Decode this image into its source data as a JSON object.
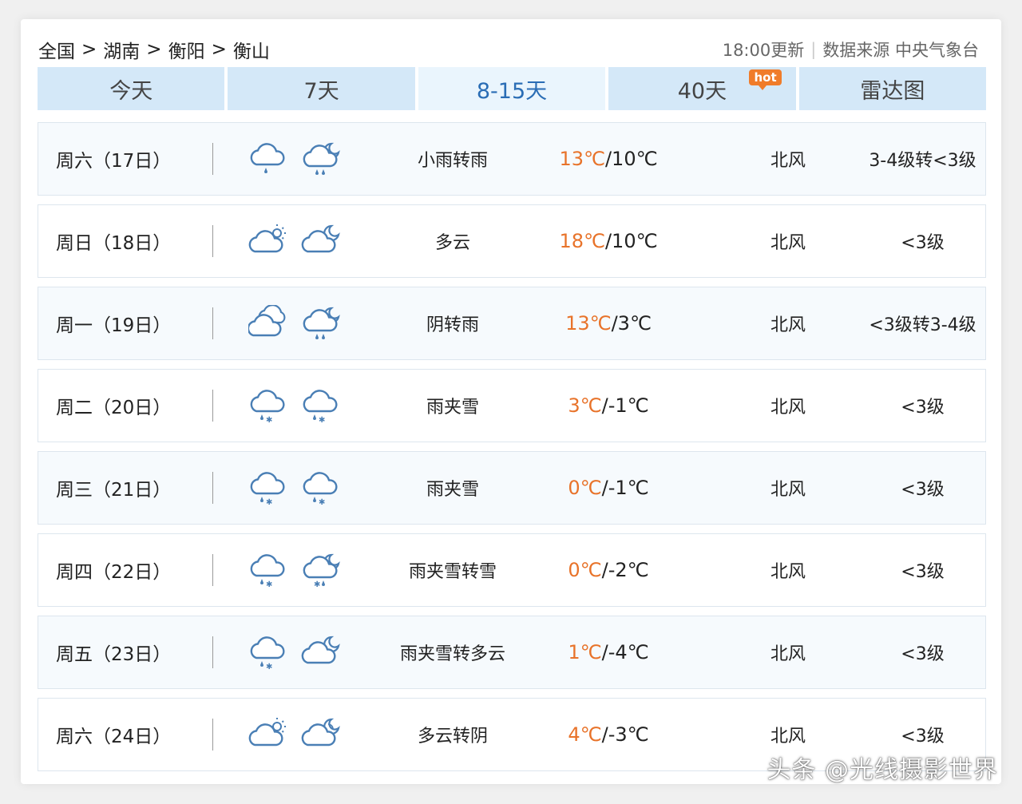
{
  "breadcrumb": [
    "全国",
    "湖南",
    "衡阳",
    "衡山"
  ],
  "breadcrumb_sep": ">",
  "update_time": "18:00更新",
  "source_label": "数据来源 中央气象台",
  "tabs": [
    {
      "label": "今天"
    },
    {
      "label": "7天"
    },
    {
      "label": "8-15天",
      "active": true
    },
    {
      "label": "40天",
      "badge": "hot"
    },
    {
      "label": "雷达图"
    }
  ],
  "colors": {
    "accent": "#2a6db5",
    "high_temp": "#e8732a",
    "tab_bg": "#d4e8f8",
    "icon": "#4a7fb5"
  },
  "forecast": [
    {
      "day": "周六（17日）",
      "icon_day": "light-rain-icon",
      "icon_night": "rain-night-icon",
      "desc": "小雨转雨",
      "high": "13℃",
      "low": "10℃",
      "wind": "北风",
      "level": "3-4级转<3级"
    },
    {
      "day": "周日（18日）",
      "icon_day": "partly-cloudy-day-icon",
      "icon_night": "partly-cloudy-night-icon",
      "desc": "多云",
      "high": "18℃",
      "low": "10℃",
      "wind": "北风",
      "level": "<3级"
    },
    {
      "day": "周一（19日）",
      "icon_day": "overcast-icon",
      "icon_night": "rain-night-icon",
      "desc": "阴转雨",
      "high": "13℃",
      "low": "3℃",
      "wind": "北风",
      "level": "<3级转3-4级"
    },
    {
      "day": "周二（20日）",
      "icon_day": "sleet-icon",
      "icon_night": "sleet-icon",
      "desc": "雨夹雪",
      "high": "3℃",
      "low": "-1℃",
      "wind": "北风",
      "level": "<3级"
    },
    {
      "day": "周三（21日）",
      "icon_day": "sleet-icon",
      "icon_night": "sleet-icon",
      "desc": "雨夹雪",
      "high": "0℃",
      "low": "-1℃",
      "wind": "北风",
      "level": "<3级"
    },
    {
      "day": "周四（22日）",
      "icon_day": "sleet-icon",
      "icon_night": "snow-night-icon",
      "desc": "雨夹雪转雪",
      "high": "0℃",
      "low": "-2℃",
      "wind": "北风",
      "level": "<3级"
    },
    {
      "day": "周五（23日）",
      "icon_day": "sleet-icon",
      "icon_night": "partly-cloudy-night-icon",
      "desc": "雨夹雪转多云",
      "high": "1℃",
      "low": "-4℃",
      "wind": "北风",
      "level": "<3级"
    },
    {
      "day": "周六（24日）",
      "icon_day": "partly-cloudy-day-icon",
      "icon_night": "cloudy-night-icon",
      "desc": "多云转阴",
      "high": "4℃",
      "low": "-3℃",
      "wind": "北风",
      "level": "<3级"
    }
  ],
  "watermark": "头条 @光线摄影世界"
}
